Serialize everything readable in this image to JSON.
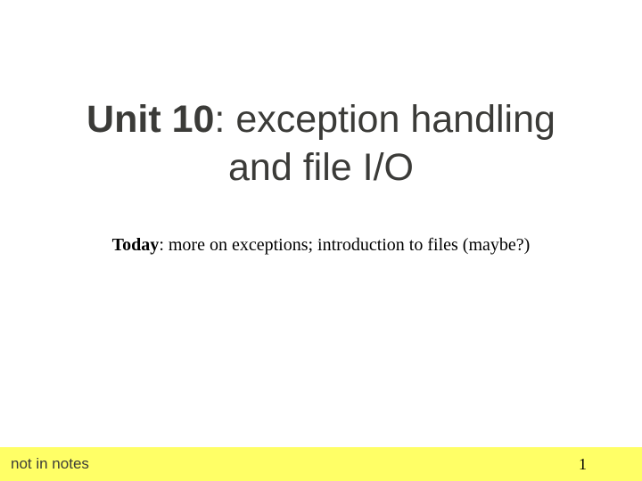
{
  "title": {
    "bold_part": "Unit 10",
    "rest_line1": ": exception handling",
    "line2": "and file I/O"
  },
  "subtitle": {
    "bold_part": "Today",
    "rest": ": more on exceptions; introduction to files (maybe?)"
  },
  "footer": {
    "left": "not in notes",
    "page_number": "1"
  }
}
